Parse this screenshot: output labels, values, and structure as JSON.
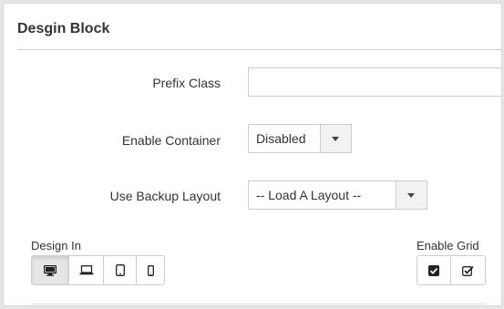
{
  "panel": {
    "title": "Desgin Block"
  },
  "fields": {
    "prefix_class": {
      "label": "Prefix Class",
      "value": "",
      "placeholder": ""
    },
    "enable_container": {
      "label": "Enable Container",
      "selected": "Disabled"
    },
    "use_backup_layout": {
      "label": "Use Backup Layout",
      "selected": "-- Load A Layout --"
    }
  },
  "design_in": {
    "label": "Design In",
    "devices": [
      {
        "name": "desktop",
        "icon": "desktop-icon",
        "active": true
      },
      {
        "name": "laptop",
        "icon": "laptop-icon",
        "active": false
      },
      {
        "name": "tablet",
        "icon": "tablet-icon",
        "active": false
      },
      {
        "name": "phone",
        "icon": "phone-icon",
        "active": false
      }
    ]
  },
  "enable_grid": {
    "label": "Enable Grid",
    "buttons": [
      {
        "name": "grid-on",
        "icon": "checkbox-checked-icon"
      },
      {
        "name": "grid-off",
        "icon": "checkbox-outline-check-icon"
      }
    ]
  }
}
